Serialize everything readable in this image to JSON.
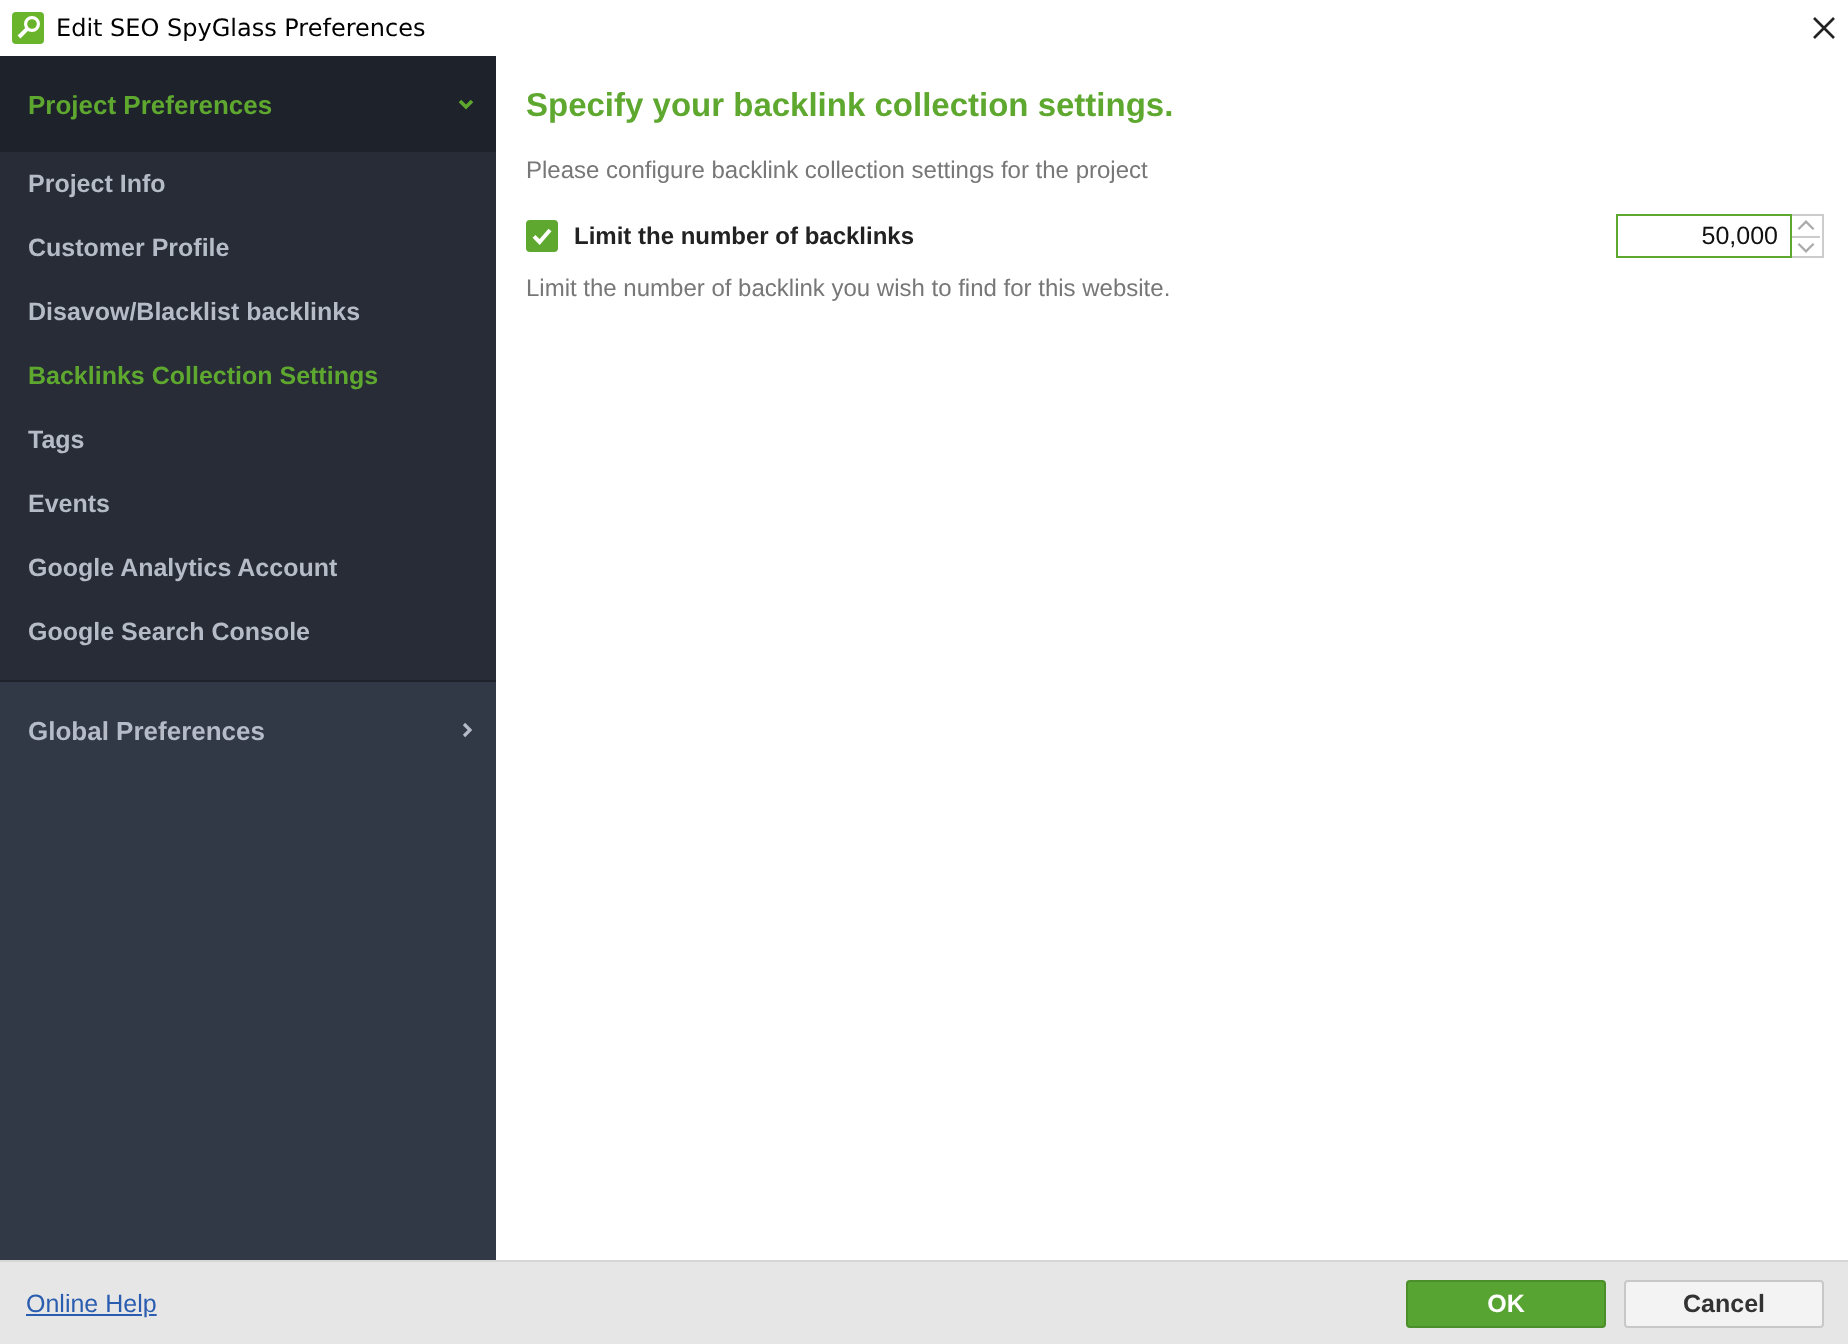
{
  "window": {
    "title": "Edit SEO SpyGlass Preferences"
  },
  "sidebar": {
    "sections": [
      {
        "label": "Project Preferences",
        "expanded": true,
        "items": [
          {
            "label": "Project Info",
            "selected": false
          },
          {
            "label": "Customer Profile",
            "selected": false
          },
          {
            "label": "Disavow/Blacklist backlinks",
            "selected": false
          },
          {
            "label": "Backlinks Collection Settings",
            "selected": true
          },
          {
            "label": "Tags",
            "selected": false
          },
          {
            "label": "Events",
            "selected": false
          },
          {
            "label": "Google Analytics Account",
            "selected": false
          },
          {
            "label": "Google Search Console",
            "selected": false
          }
        ]
      },
      {
        "label": "Global Preferences",
        "expanded": false
      }
    ]
  },
  "content": {
    "heading": "Specify your backlink collection settings.",
    "description": "Please configure backlink collection settings for the project",
    "setting": {
      "label": "Limit the number of backlinks",
      "checked": true,
      "value": "50,000",
      "hint": "Limit the number of backlink you wish to find for this website."
    }
  },
  "footer": {
    "help_link": "Online Help",
    "buttons": [
      {
        "label": "OK",
        "kind": "primary"
      },
      {
        "label": "Cancel",
        "kind": "secondary"
      }
    ]
  }
}
